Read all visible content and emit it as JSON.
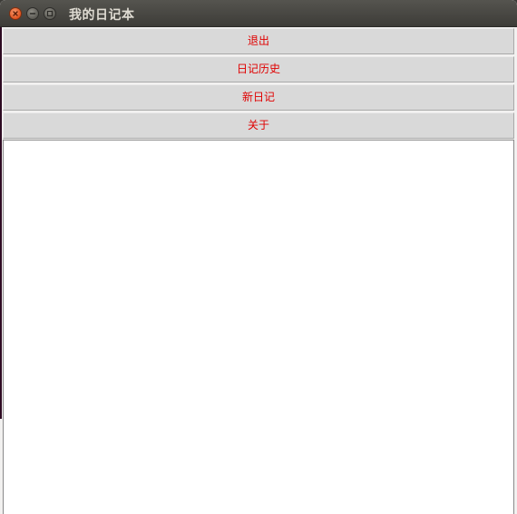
{
  "window": {
    "title": "我的日记本"
  },
  "buttons": {
    "exit_label": "退出",
    "history_label": "日记历史",
    "new_label": "新日记",
    "about_label": "关于"
  },
  "colors": {
    "button_text": "#e00000",
    "button_bg": "#d9d9d9",
    "titlebar": "#3d3c38",
    "close_button": "#e0531f"
  },
  "icons": [
    "close-icon",
    "minimize-icon",
    "maximize-icon"
  ]
}
